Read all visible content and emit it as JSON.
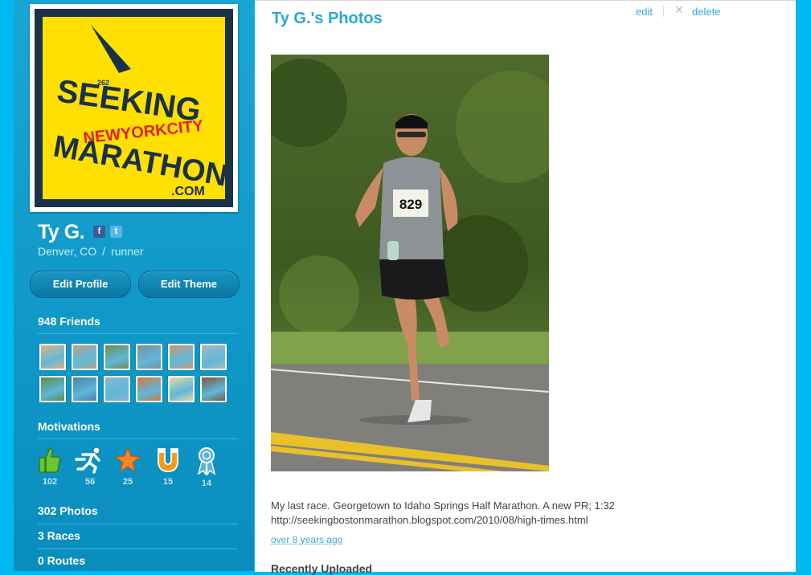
{
  "profile": {
    "name": "Ty G.",
    "location": "Denver, CO",
    "separator": "/",
    "role": "runner",
    "social": {
      "facebook": "f",
      "twitter": "t"
    },
    "logo_text": [
      "262",
      "SEEKING",
      "NEWYORKCITY",
      "MARATHON",
      ".COM"
    ]
  },
  "buttons": {
    "edit_profile": "Edit Profile",
    "edit_theme": "Edit Theme"
  },
  "friends": {
    "title": "948 Friends",
    "thumbs": [
      "#d9b48a",
      "#b7a48f",
      "#6f8a5a",
      "#7a8ea0",
      "#c99a78",
      "#a9b7c4",
      "#5e8c4f",
      "#4f7fa8",
      "#8fb2cf",
      "#d07a3c",
      "#e3d7a8",
      "#7b5a45"
    ]
  },
  "motivations": {
    "title": "Motivations",
    "items": [
      {
        "icon": "thumbs-up-icon",
        "count": "102"
      },
      {
        "icon": "runner-icon",
        "count": "56"
      },
      {
        "icon": "star-icon",
        "count": "25"
      },
      {
        "icon": "magnet-icon",
        "count": "15"
      },
      {
        "icon": "ribbon-icon",
        "count": "14"
      }
    ]
  },
  "links": {
    "photos": "302 Photos",
    "races": "3 Races",
    "routes": "0 Routes"
  },
  "main": {
    "title": "Ty G.'s Photos",
    "edit": "edit",
    "close_glyph": "✕",
    "delete": "delete",
    "bib": "829",
    "caption_line1": "My last race. Georgetown to Idaho Springs Half Marathon. A new PR; 1:32",
    "caption_line2": "http://seekingbostonmarathon.blogspot.com/2010/08/high-times.html",
    "time_ago": "over 8 years ago",
    "recent_title": "Recently Uploaded"
  },
  "colors": {
    "sidebar": "#1aa6d4",
    "page_bg": "#00b9f0",
    "accent_link": "#3aa7d6"
  }
}
